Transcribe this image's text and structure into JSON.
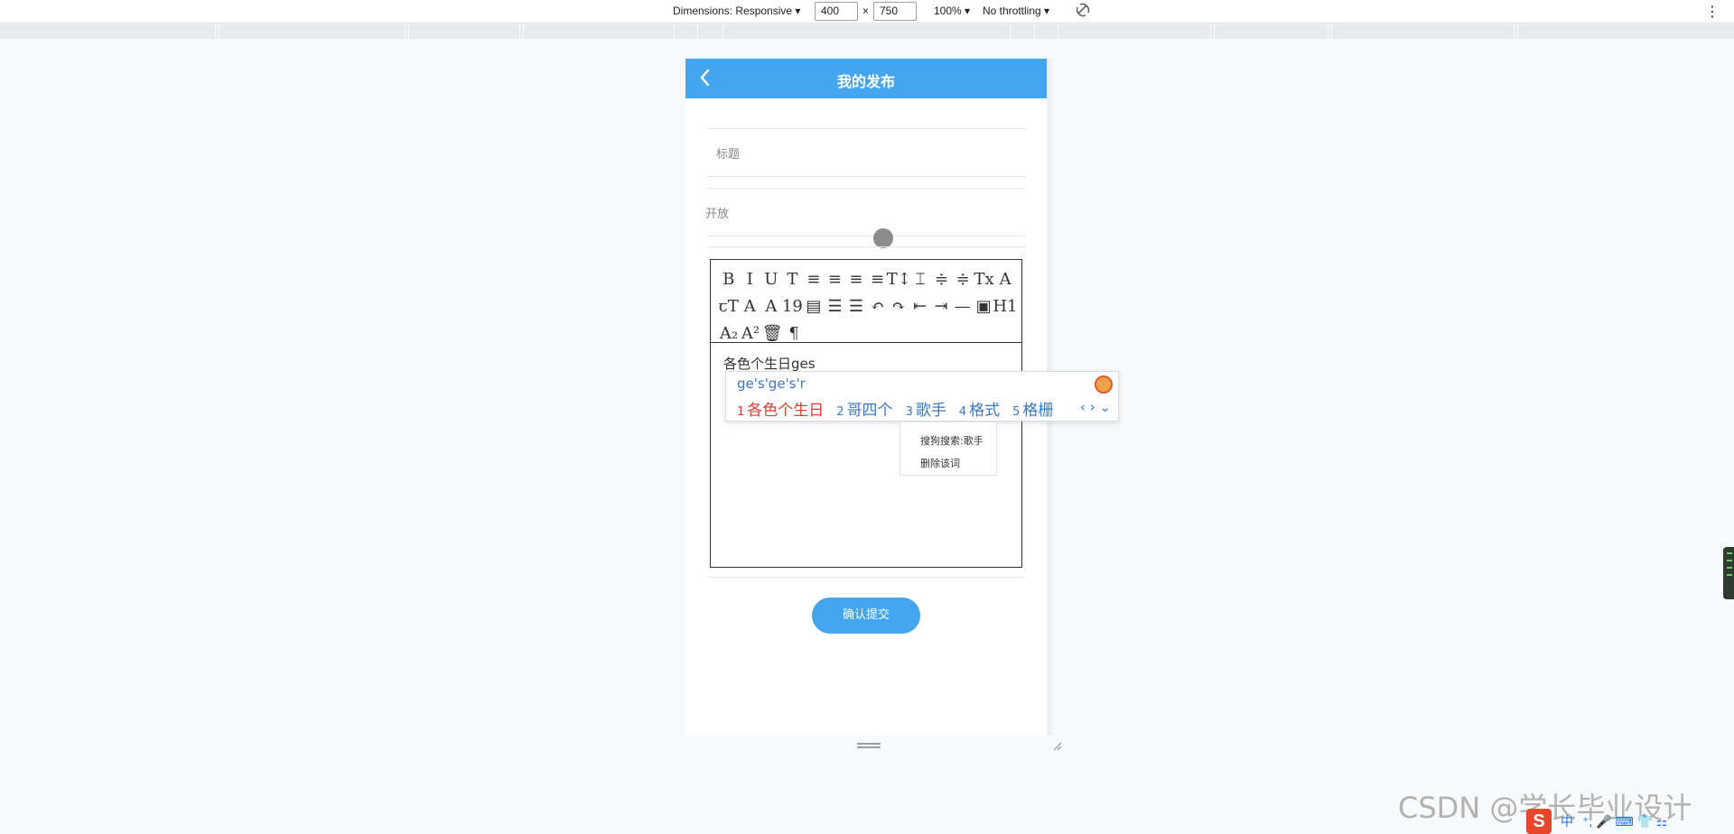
{
  "devtools": {
    "dimensions_label": "Dimensions: Responsive",
    "width_value": "400",
    "times": "×",
    "height_value": "750",
    "zoom_label": "100%",
    "throttling_label": "No throttling",
    "more_icon": "kebab-icon",
    "rotate_icon": "rotate-icon"
  },
  "header": {
    "back_icon": "chevron-left-icon",
    "title": "我的发布",
    "color": "#43a6ee"
  },
  "form": {
    "title_placeholder": "标题",
    "open_label": "开放"
  },
  "toolbar": {
    "rows": [
      [
        "B",
        "I",
        "U",
        "T",
        "≡",
        "≡",
        "≡",
        "≡",
        "T↕",
        "⌶",
        "≑",
        "≑",
        "Tx",
        "A"
      ],
      [
        "ꞇT",
        "A",
        "A",
        "19",
        "▤",
        "☰",
        "☰",
        "↶",
        "↷",
        "⇤",
        "⇥",
        "—",
        "▣",
        "H1"
      ],
      [
        "A₂",
        "A²",
        "🗑",
        "¶"
      ]
    ]
  },
  "editor": {
    "content_text": "各色个生日ges"
  },
  "ime": {
    "composition": "ge's'ge's'r",
    "candidates": [
      {
        "num": "1",
        "text": "各色个生日"
      },
      {
        "num": "2",
        "text": "哥四个"
      },
      {
        "num": "3",
        "text": "歌手"
      },
      {
        "num": "4",
        "text": "格式"
      },
      {
        "num": "5",
        "text": "格栅"
      }
    ],
    "nav": "‹ › ⌄",
    "context_menu": [
      "搜狗搜索:歌手",
      "删除该词"
    ]
  },
  "submit": {
    "label": "确认提交"
  },
  "watermark": "CSDN @学长毕业设计",
  "tray": {
    "ime_label": "中",
    "items": "⁺, 🎤 ⌨ 👕 ⚏"
  }
}
